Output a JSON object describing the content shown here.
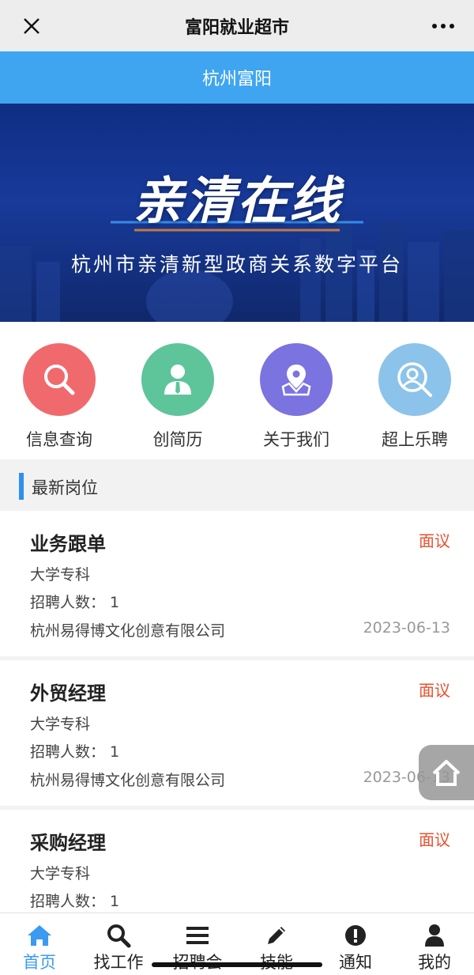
{
  "header": {
    "title": "富阳就业超市"
  },
  "city": {
    "name": "杭州富阳"
  },
  "banner": {
    "heading": "亲清在线",
    "subheading": "杭州市亲清新型政商关系数字平台"
  },
  "quick_actions": [
    {
      "label": "信息查询",
      "icon": "search-icon",
      "color": "#f06a6d"
    },
    {
      "label": "创简历",
      "icon": "person-icon",
      "color": "#5ec49a"
    },
    {
      "label": "关于我们",
      "icon": "map-pin-icon",
      "color": "#7b73e0"
    },
    {
      "label": "超上乐聘",
      "icon": "profile-search-icon",
      "color": "#8cc3ea"
    }
  ],
  "section": {
    "title": "最新岗位"
  },
  "jobs": [
    {
      "title": "业务跟单",
      "salary": "面议",
      "education": "大学专科",
      "headcount": "招聘人数：  1",
      "company": "杭州易得博文化创意有限公司",
      "date": "2023-06-13"
    },
    {
      "title": "外贸经理",
      "salary": "面议",
      "education": "大学专科",
      "headcount": "招聘人数：  1",
      "company": "杭州易得博文化创意有限公司",
      "date": "2023-06-13"
    },
    {
      "title": "采购经理",
      "salary": "面议",
      "education": "大学专科",
      "headcount": "招聘人数：  1",
      "company": "",
      "date": ""
    }
  ],
  "tabs": [
    {
      "label": "首页",
      "icon": "home-icon",
      "active": true
    },
    {
      "label": "找工作",
      "icon": "search-icon"
    },
    {
      "label": "招聘会",
      "icon": "list-icon"
    },
    {
      "label": "技能",
      "icon": "pencil-icon"
    },
    {
      "label": "通知",
      "icon": "alert-icon"
    },
    {
      "label": "我的",
      "icon": "user-icon"
    }
  ],
  "colors": {
    "accent": "#3fa5f0",
    "salary": "#e8502f",
    "tab_active": "#3a9bf0"
  }
}
